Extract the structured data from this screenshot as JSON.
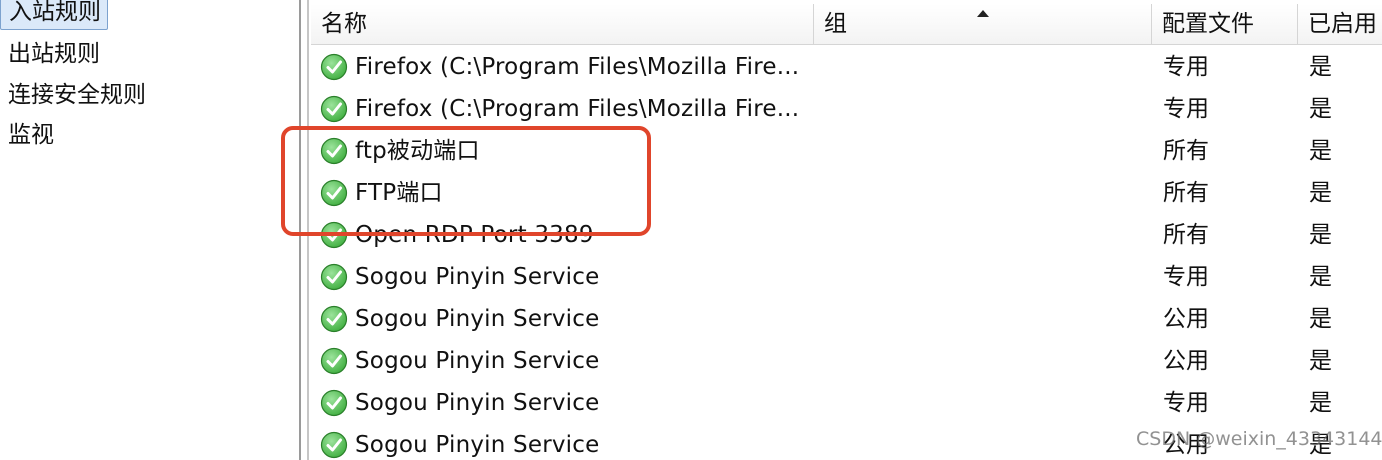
{
  "nav": {
    "items": [
      {
        "label": "入站规则",
        "selected": true
      },
      {
        "label": "出站规则",
        "selected": false
      },
      {
        "label": "连接安全规则",
        "selected": false
      },
      {
        "label": "监视",
        "selected": false
      }
    ]
  },
  "table": {
    "columns": {
      "name": "名称",
      "group": "组",
      "profile": "配置文件",
      "enabled": "已启用"
    },
    "sort": {
      "column": "group",
      "direction": "ascending"
    },
    "rows": [
      {
        "name": "Firefox (C:\\Program Files\\Mozilla Fire...",
        "group": "",
        "profile": "专用",
        "enabled": "是"
      },
      {
        "name": "Firefox (C:\\Program Files\\Mozilla Fire...",
        "group": "",
        "profile": "专用",
        "enabled": "是"
      },
      {
        "name": "ftp被动端口",
        "group": "",
        "profile": "所有",
        "enabled": "是"
      },
      {
        "name": "FTP端口",
        "group": "",
        "profile": "所有",
        "enabled": "是"
      },
      {
        "name": "Open RDP Port 3389",
        "group": "",
        "profile": "所有",
        "enabled": "是"
      },
      {
        "name": "Sogou Pinyin Service",
        "group": "",
        "profile": "专用",
        "enabled": "是"
      },
      {
        "name": "Sogou Pinyin Service",
        "group": "",
        "profile": "公用",
        "enabled": "是"
      },
      {
        "name": "Sogou Pinyin Service",
        "group": "",
        "profile": "公用",
        "enabled": "是"
      },
      {
        "name": "Sogou Pinyin Service",
        "group": "",
        "profile": "专用",
        "enabled": "是"
      },
      {
        "name": "Sogou Pinyin Service",
        "group": "",
        "profile": "公用",
        "enabled": "是"
      }
    ],
    "row_icon": "green-check-icon"
  },
  "annotation": {
    "color": "#e0452b"
  },
  "colors": {
    "check_green": "#3fae3f",
    "selected_bg": "#dbe9f9"
  },
  "watermark": "CSDN @weixin_43343144"
}
